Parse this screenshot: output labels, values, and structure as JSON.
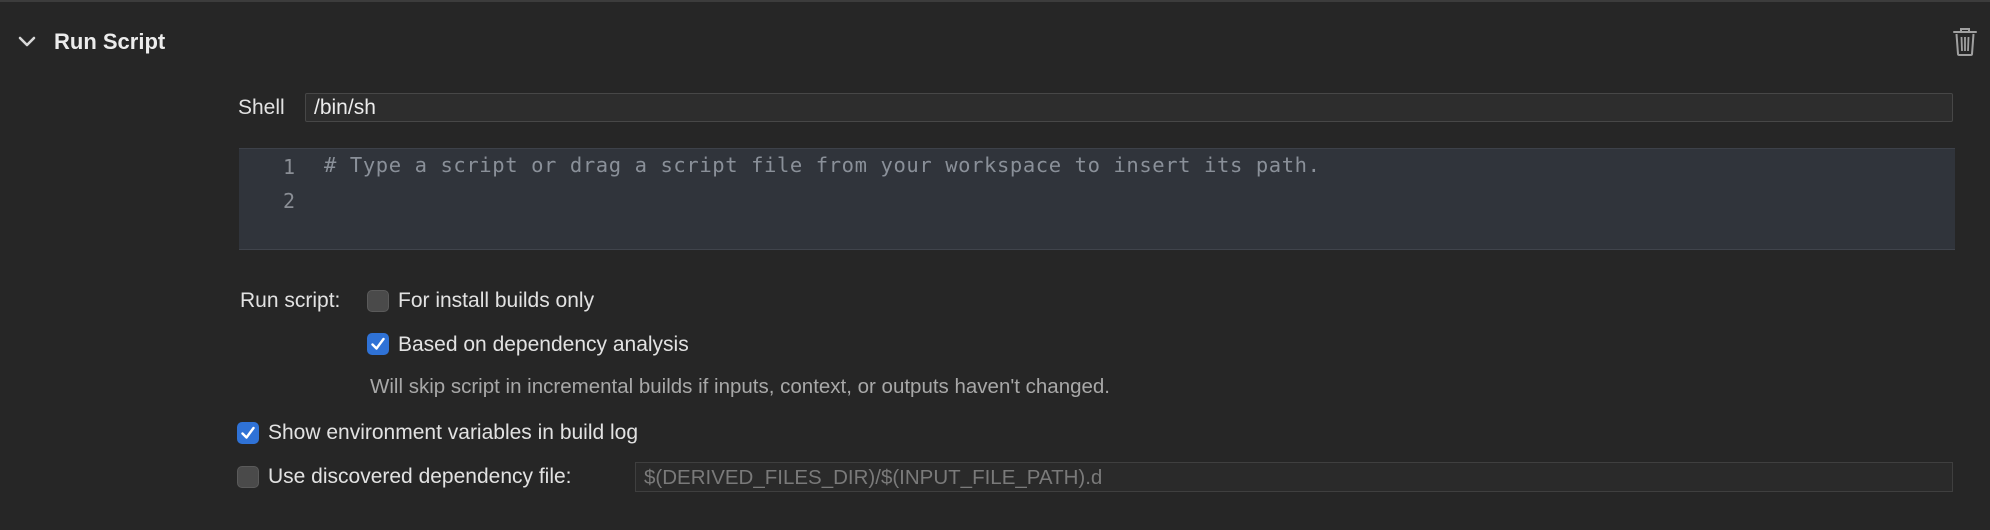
{
  "phase": {
    "title": "Run Script",
    "expanded": true,
    "disclosure_icon": "chevron-down-icon",
    "delete_icon": "trash-icon"
  },
  "shell": {
    "label": "Shell",
    "value": "/bin/sh"
  },
  "script_editor": {
    "line_numbers": [
      "1",
      "2"
    ],
    "lines": [
      "# Type a script or drag a script file from your workspace to insert its path.",
      ""
    ]
  },
  "run_script": {
    "label": "Run script:",
    "options": [
      {
        "label": "For install builds only",
        "checked": false
      },
      {
        "label": "Based on dependency analysis",
        "checked": true
      }
    ],
    "note": "Will skip script in incremental builds if inputs, context, or outputs haven't changed."
  },
  "show_env": {
    "label": "Show environment variables in build log",
    "checked": true
  },
  "dependency_file": {
    "label": "Use discovered dependency file:",
    "checked": false,
    "placeholder": "$(DERIVED_FILES_DIR)/$(INPUT_FILE_PATH).d"
  },
  "colors": {
    "background": "#262626",
    "editor_background": "#30343b",
    "accent": "#2f72d6"
  }
}
